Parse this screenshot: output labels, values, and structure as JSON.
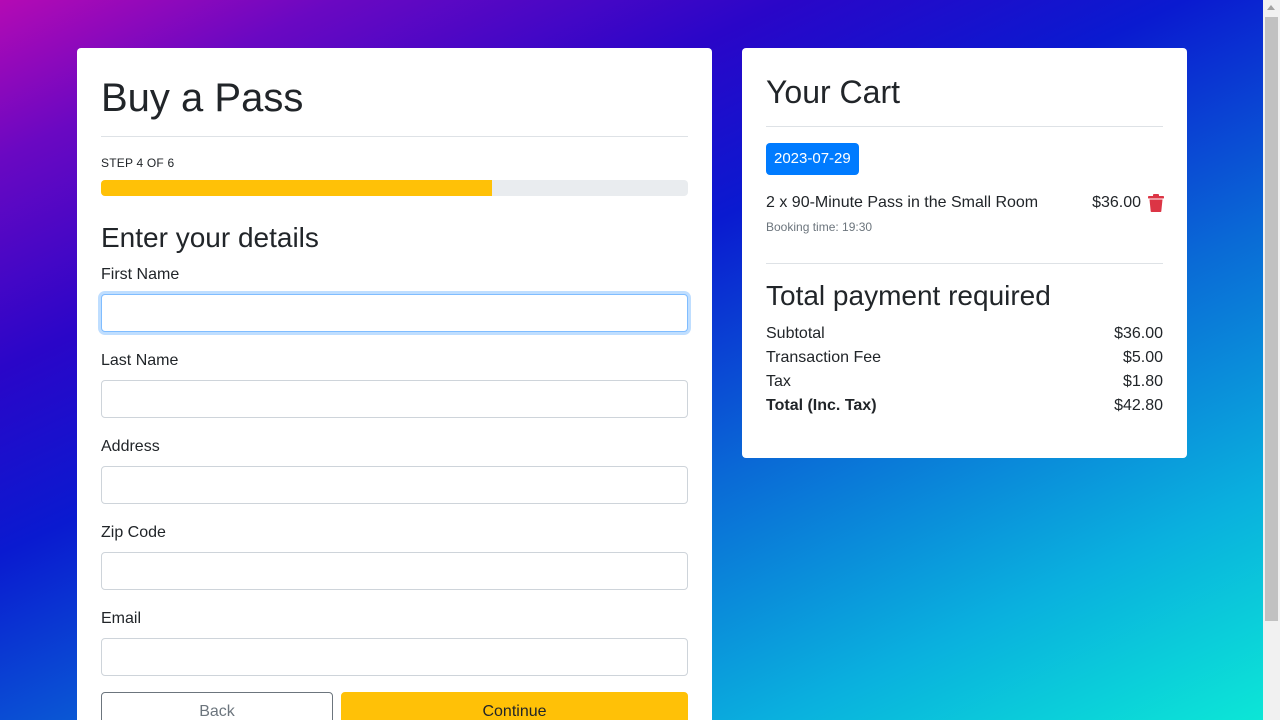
{
  "booking": {
    "title": "Buy a Pass",
    "step_label": "STEP 4 OF 6",
    "progress_fraction": 0.6667,
    "progress_color": "#ffc107",
    "section_title": "Enter your details",
    "fields": [
      {
        "label": "First Name",
        "value": "",
        "focused": true
      },
      {
        "label": "Last Name",
        "value": ""
      },
      {
        "label": "Address",
        "value": ""
      },
      {
        "label": "Zip Code",
        "value": ""
      },
      {
        "label": "Email",
        "value": ""
      }
    ],
    "back_label": "Back",
    "continue_label": "Continue"
  },
  "cart": {
    "title": "Your Cart",
    "date": "2023-07-29",
    "item": {
      "name": "2 x 90-Minute Pass in the Small Room",
      "price": "$36.00",
      "booking_time": "Booking time: 19:30",
      "remove_icon": "trash-icon"
    },
    "total_title": "Total payment required",
    "summary": [
      {
        "label": "Subtotal",
        "amount": "$36.00"
      },
      {
        "label": "Transaction Fee",
        "amount": "$5.00"
      },
      {
        "label": "Tax",
        "amount": "$1.80"
      },
      {
        "label": "Total (Inc. Tax)",
        "amount": "$42.80"
      }
    ]
  },
  "colors": {
    "primary": "#007bff",
    "warning": "#ffc107",
    "danger": "#dc3545",
    "secondary": "#6c757d"
  }
}
